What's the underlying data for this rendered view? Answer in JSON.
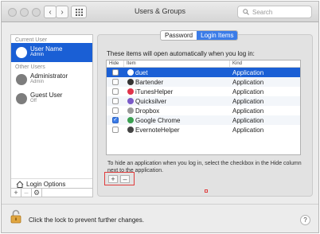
{
  "window": {
    "title": "Users & Groups"
  },
  "search": {
    "placeholder": "Search"
  },
  "sidebar": {
    "current_header": "Current User",
    "current_user": {
      "name": "User Name",
      "role": "Admin"
    },
    "other_header": "Other Users",
    "others": [
      {
        "name": "Administrator",
        "role": "Admin"
      },
      {
        "name": "Guest User",
        "role": "Off"
      }
    ],
    "login_options": "Login Options",
    "add": "+",
    "remove": "–",
    "gear": "⚙"
  },
  "tabs": [
    {
      "label": "Password"
    },
    {
      "label": "Login Items"
    }
  ],
  "login_items": {
    "description": "These items will open automatically when you log in:",
    "columns": [
      "Hide",
      "Item",
      "Kind"
    ],
    "rows": [
      {
        "name": "duet",
        "kind": "Application",
        "hide": false,
        "icon": "duet-icon",
        "color": "#ffffff"
      },
      {
        "name": "Bartender",
        "kind": "Application",
        "hide": false,
        "icon": "bartender-icon",
        "color": "#333333"
      },
      {
        "name": "iTunesHelper",
        "kind": "Application",
        "hide": false,
        "icon": "itunes-icon",
        "color": "#e0334a"
      },
      {
        "name": "Quicksilver",
        "kind": "Application",
        "hide": false,
        "icon": "quicksilver-icon",
        "color": "#7a5ac8"
      },
      {
        "name": "Dropbox",
        "kind": "Application",
        "hide": false,
        "icon": "dropbox-icon",
        "color": "#9a9a9a"
      },
      {
        "name": "Google Chrome",
        "kind": "Application",
        "hide": true,
        "icon": "chrome-icon",
        "color": "#3aa050"
      },
      {
        "name": "EvernoteHelper",
        "kind": "Application",
        "hide": false,
        "icon": "evernote-icon",
        "color": "#444444"
      }
    ],
    "hint": "To hide an application when you log in, select the checkbox in the Hide column next to the application.",
    "add": "+",
    "remove": "–"
  },
  "footer": {
    "lock_text": "Click the lock to prevent further changes.",
    "help": "?"
  },
  "colors": {
    "selection": "#1a5fd5",
    "accent": "#3b7ce8",
    "highlight_box": "#e03c3c"
  }
}
